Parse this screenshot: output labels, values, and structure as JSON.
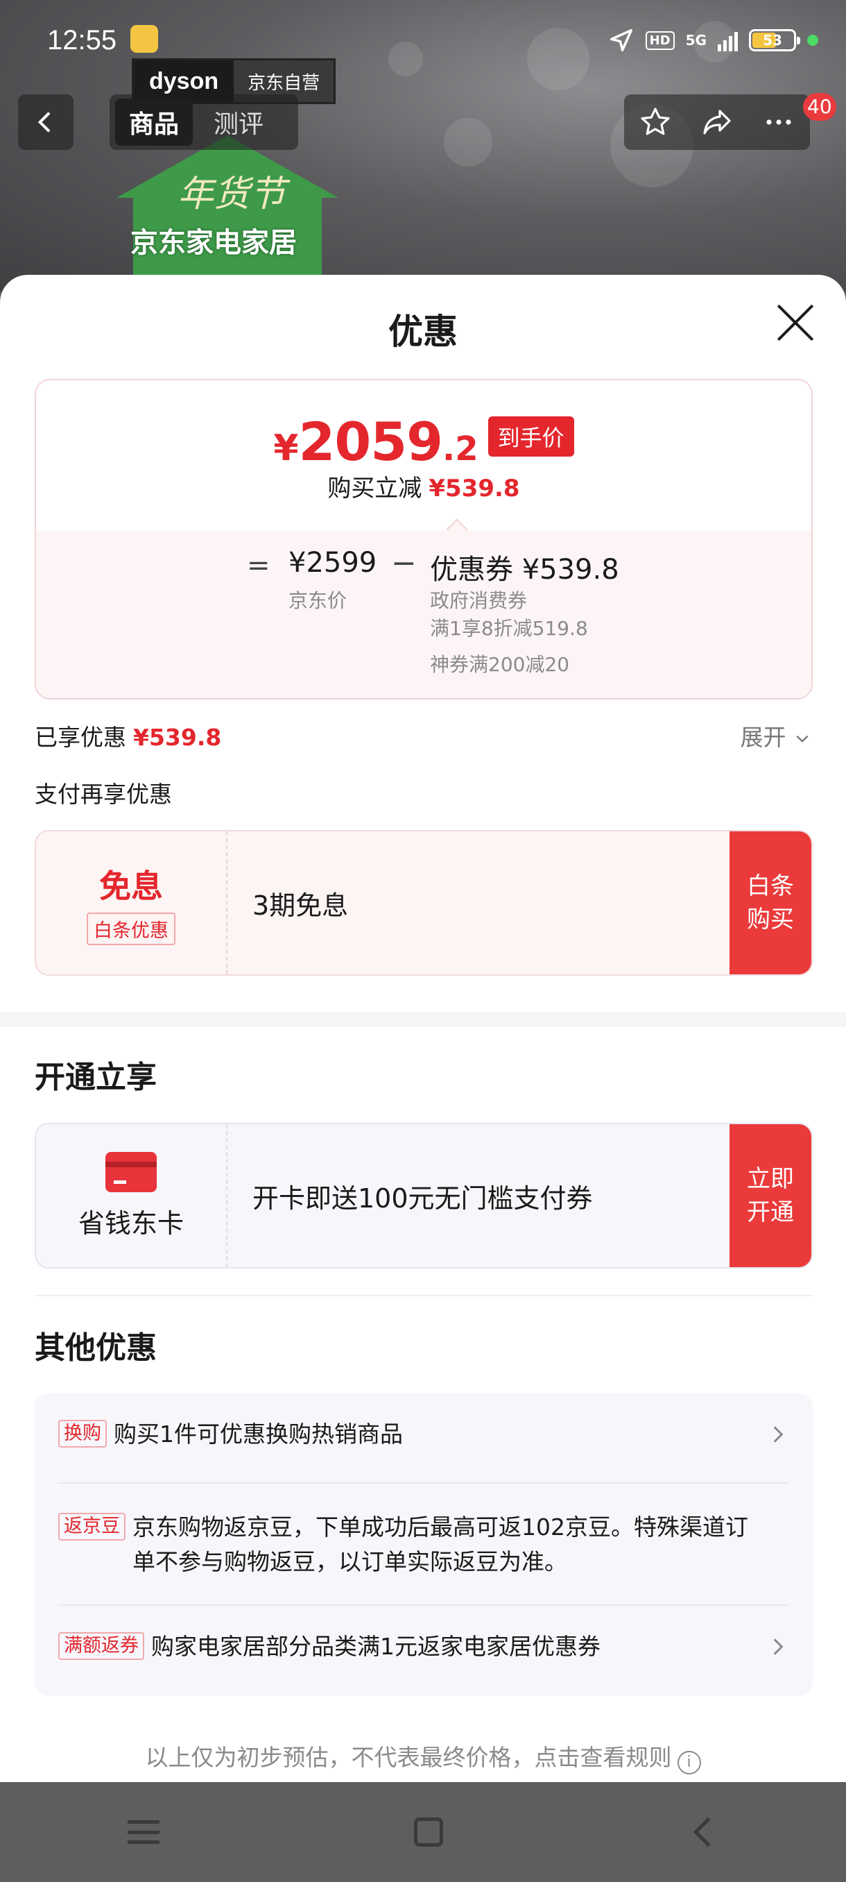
{
  "status_bar": {
    "time": "12:55",
    "network": "5G",
    "hd": "HD",
    "battery": "53"
  },
  "product_bg": {
    "brand": "dyson",
    "self_operated": "京东自营",
    "tabs": [
      "商品",
      "测评"
    ],
    "badge_count": "40",
    "banner_title": "年货节",
    "banner_subtitle": "京东家电家居"
  },
  "sheet": {
    "title": "优惠",
    "price": {
      "currency": "¥",
      "integer": "2059",
      "decimal": ".2",
      "tag": "到手价"
    },
    "save_label": "购买立减",
    "save_amount": "¥539.8",
    "breakdown": {
      "equals": "=",
      "jd_price": "¥2599",
      "jd_price_label": "京东价",
      "minus": "−",
      "coupon_total": "优惠券 ¥539.8",
      "coupon_details": [
        "政府消费券",
        "满1享8折减519.8",
        "神券满200减20"
      ]
    },
    "enjoyed_label": "已享优惠",
    "enjoyed_amount": "¥539.8",
    "expand_label": "展开",
    "pay_more_label": "支付再享优惠",
    "baitiao": {
      "title": "免息",
      "tag": "白条优惠",
      "desc": "3期免息",
      "button": "白条 购买"
    },
    "open_section_title": "开通立享",
    "card_offer": {
      "title": "省钱东卡",
      "desc": "开卡即送100元无门槛支付券",
      "button": "立即 开通"
    },
    "other_title": "其他优惠",
    "other_items": [
      {
        "tag": "换购",
        "text": "购买1件可优惠换购热销商品"
      },
      {
        "tag": "返京豆",
        "text": "京东购物返京豆，下单成功后最高可返102京豆。特殊渠道订单不参与购物返豆，以订单实际返豆为准。"
      },
      {
        "tag": "满额返券",
        "text": "购家电家居部分品类满1元返家电家居优惠券"
      }
    ],
    "disclaimer": "以上仅为初步预估，不代表最终价格，点击查看规则"
  },
  "icons": {
    "back": "chevron-left-icon",
    "star": "star-icon",
    "share": "share-icon",
    "more": "more-icon",
    "close": "close-icon",
    "chevron_right": "chevron-right-icon",
    "info": "info-icon"
  },
  "colors": {
    "accent": "#e4262d",
    "button_red": "#ea3a3a"
  }
}
